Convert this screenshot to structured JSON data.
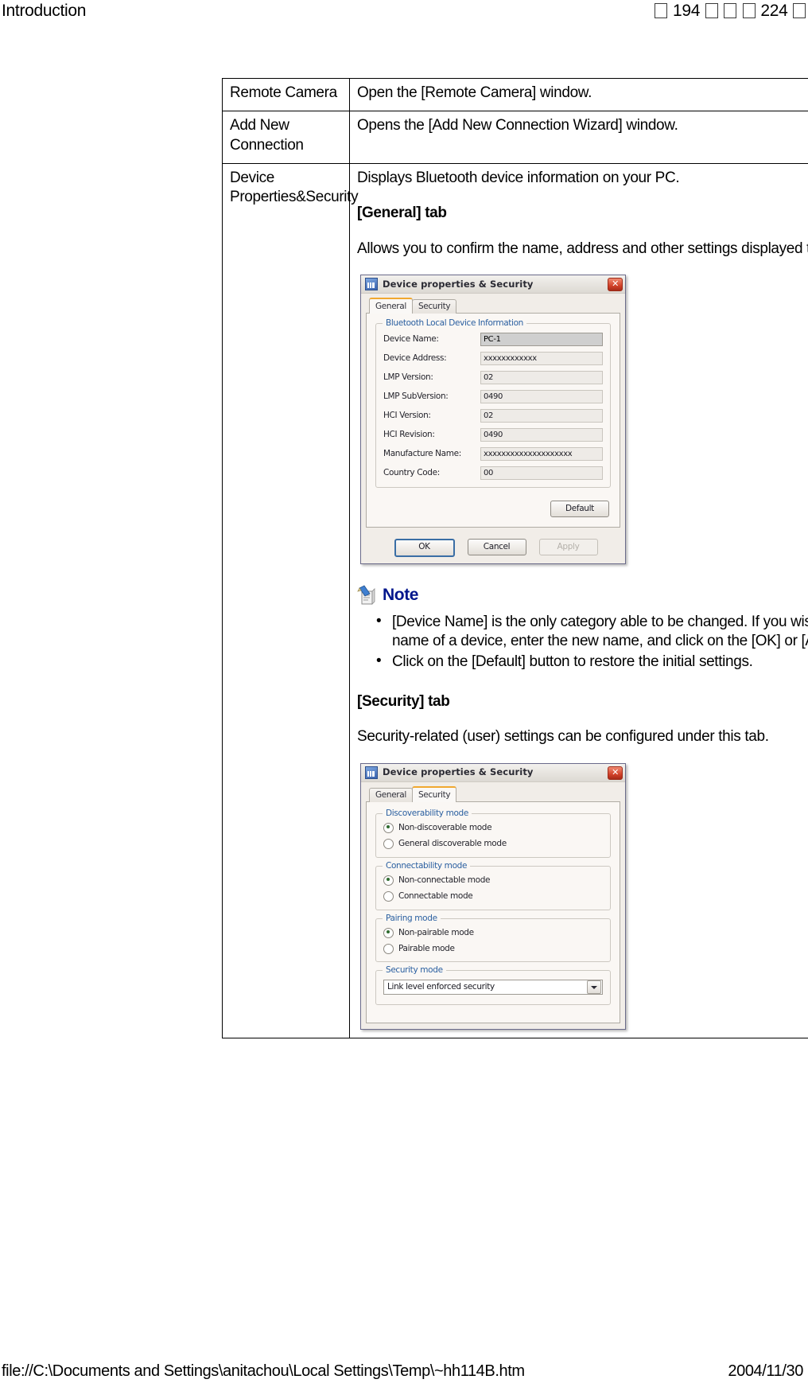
{
  "header": {
    "left_title": "Introduction",
    "page_current": "194",
    "page_total": "224",
    "cjk_note": "第 194 頁，共 224 頁 (CJK glyphs render as missing-glyph boxes)"
  },
  "footer": {
    "file_path": "file://C:\\Documents and Settings\\anitachou\\Local Settings\\Temp\\~hh114B.htm",
    "date": "2004/11/30"
  },
  "table": {
    "rows": [
      {
        "term": "Remote Camera",
        "desc": "Open the [Remote Camera] window."
      },
      {
        "term": "Add New Connection",
        "desc": "Opens the [Add New Connection Wizard] window."
      },
      {
        "term": "Device Properties&Security",
        "desc_paragraphs": [
          "Displays Bluetooth device information on your PC.",
          "[General] tab",
          "Allows you to confirm the name, address and other settings displayed to other devices.",
          "[Security] tab",
          "Security-related (user) settings can be configured under this tab."
        ]
      }
    ]
  },
  "note": {
    "icon": "note-pencil-paper-icon",
    "label": "Note",
    "color": "#00158c",
    "bullets": [
      "[Device Name] is the only category able to be changed. If you wish to change the name of a device, enter the new name, and click on the [OK] or [Apply] button.",
      "Click on the [Default] button to restore the initial settings."
    ]
  },
  "dialog_general": {
    "title": "Device properties & Security",
    "icon": "bluetooth-device-icon",
    "close_label": "✕",
    "tabs": [
      {
        "label": "General",
        "active": true
      },
      {
        "label": "Security",
        "active": false
      }
    ],
    "group_label": "Bluetooth Local Device Information",
    "fields": [
      {
        "label": "Device Name:",
        "value": "PC-1",
        "editable": true,
        "selected": true
      },
      {
        "label": "Device Address:",
        "value": "xxxxxxxxxxxx",
        "editable": false,
        "selected": false
      },
      {
        "label": "LMP Version:",
        "value": "02",
        "editable": false,
        "selected": false
      },
      {
        "label": "LMP SubVersion:",
        "value": "0490",
        "editable": false,
        "selected": false
      },
      {
        "label": "HCI Version:",
        "value": "02",
        "editable": false,
        "selected": false
      },
      {
        "label": "HCI Revision:",
        "value": "0490",
        "editable": false,
        "selected": false
      },
      {
        "label": "Manufacture Name:",
        "value": "xxxxxxxxxxxxxxxxxxxx",
        "editable": false,
        "selected": false
      },
      {
        "label": "Country Code:",
        "value": "00",
        "editable": false,
        "selected": false
      }
    ],
    "default_button": "Default",
    "footer_buttons": [
      {
        "label": "OK",
        "state": "primary"
      },
      {
        "label": "Cancel",
        "state": "normal"
      },
      {
        "label": "Apply",
        "state": "disabled"
      }
    ]
  },
  "dialog_security": {
    "title": "Device properties & Security",
    "icon": "bluetooth-device-icon",
    "close_label": "✕",
    "tabs": [
      {
        "label": "General",
        "active": false
      },
      {
        "label": "Security",
        "active": true
      }
    ],
    "groups": [
      {
        "label": "Discoverability mode",
        "options": [
          {
            "label": "Non-discoverable mode",
            "selected": true
          },
          {
            "label": "General discoverable mode",
            "selected": false
          }
        ]
      },
      {
        "label": "Connectability mode",
        "options": [
          {
            "label": "Non-connectable mode",
            "selected": true
          },
          {
            "label": "Connectable mode",
            "selected": false
          }
        ]
      },
      {
        "label": "Pairing mode",
        "options": [
          {
            "label": "Non-pairable mode",
            "selected": true
          },
          {
            "label": "Pairable mode",
            "selected": false
          }
        ]
      },
      {
        "label": "Security mode",
        "combo_value": "Link level enforced security"
      }
    ]
  }
}
